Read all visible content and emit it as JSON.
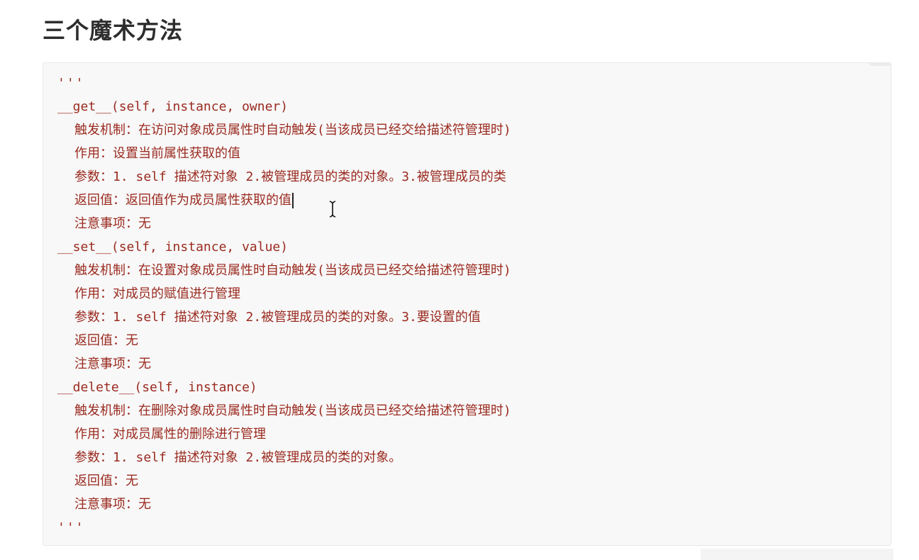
{
  "heading": "三个魔术方法",
  "code": {
    "open_quotes": "'''",
    "close_quotes": "'''",
    "methods": [
      {
        "signature": "__get__(self, instance, owner)",
        "lines": [
          "触发机制：在访问对象成员属性时自动触发(当该成员已经交给描述符管理时)",
          "作用：设置当前属性获取的值",
          "参数：1. self 描述符对象 2.被管理成员的类的对象。3.被管理成员的类",
          "返回值：返回值作为成员属性获取的值",
          "注意事项：无"
        ]
      },
      {
        "signature": "__set__(self, instance, value)",
        "lines": [
          "触发机制：在设置对象成员属性时自动触发(当该成员已经交给描述符管理时)",
          "作用：对成员的赋值进行管理",
          "参数：1. self 描述符对象 2.被管理成员的类的对象。3.要设置的值",
          "返回值：无",
          "注意事项：无"
        ]
      },
      {
        "signature": "__delete__(self, instance)",
        "lines": [
          "触发机制：在删除对象成员属性时自动触发(当该成员已经交给描述符管理时)",
          "作用：对成员属性的删除进行管理",
          "参数：1. self 描述符对象 2.被管理成员的类的对象。",
          "返回值：无",
          "注意事项：无"
        ]
      }
    ]
  },
  "colors": {
    "code_text": "#9a2a1f",
    "code_background": "#f8f8f8",
    "heading_text": "#2d2d2d"
  },
  "cursor_icon": "text-ibeam-cursor-icon"
}
